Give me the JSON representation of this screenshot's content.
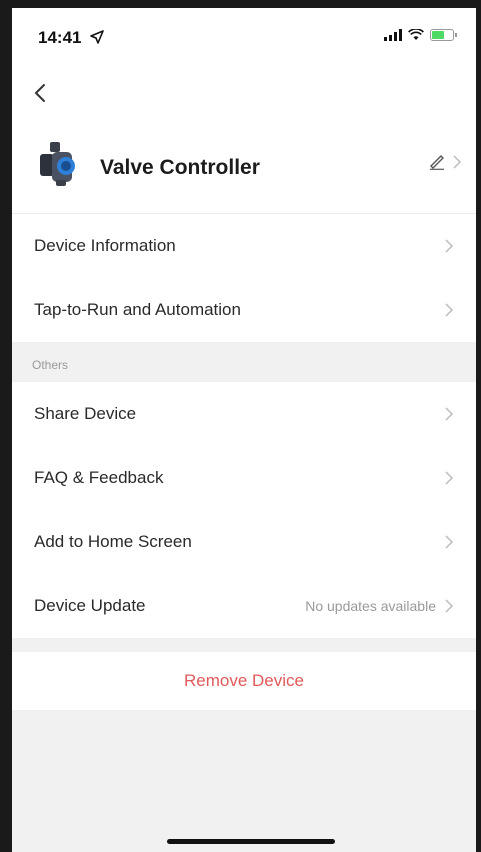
{
  "status_bar": {
    "time": "14:41"
  },
  "device": {
    "name": "Valve Controller"
  },
  "group1": [
    {
      "label": "Device Information"
    },
    {
      "label": "Tap-to-Run and Automation"
    }
  ],
  "section": {
    "others_label": "Others"
  },
  "group2": [
    {
      "label": "Share Device",
      "value": ""
    },
    {
      "label": "FAQ & Feedback",
      "value": ""
    },
    {
      "label": "Add to Home Screen",
      "value": ""
    },
    {
      "label": "Device Update",
      "value": "No updates available"
    }
  ],
  "remove": {
    "label": "Remove Device"
  },
  "colors": {
    "danger": "#e15a5a",
    "secondary_text": "#9a9a9a",
    "background": "#f1f1f1"
  }
}
